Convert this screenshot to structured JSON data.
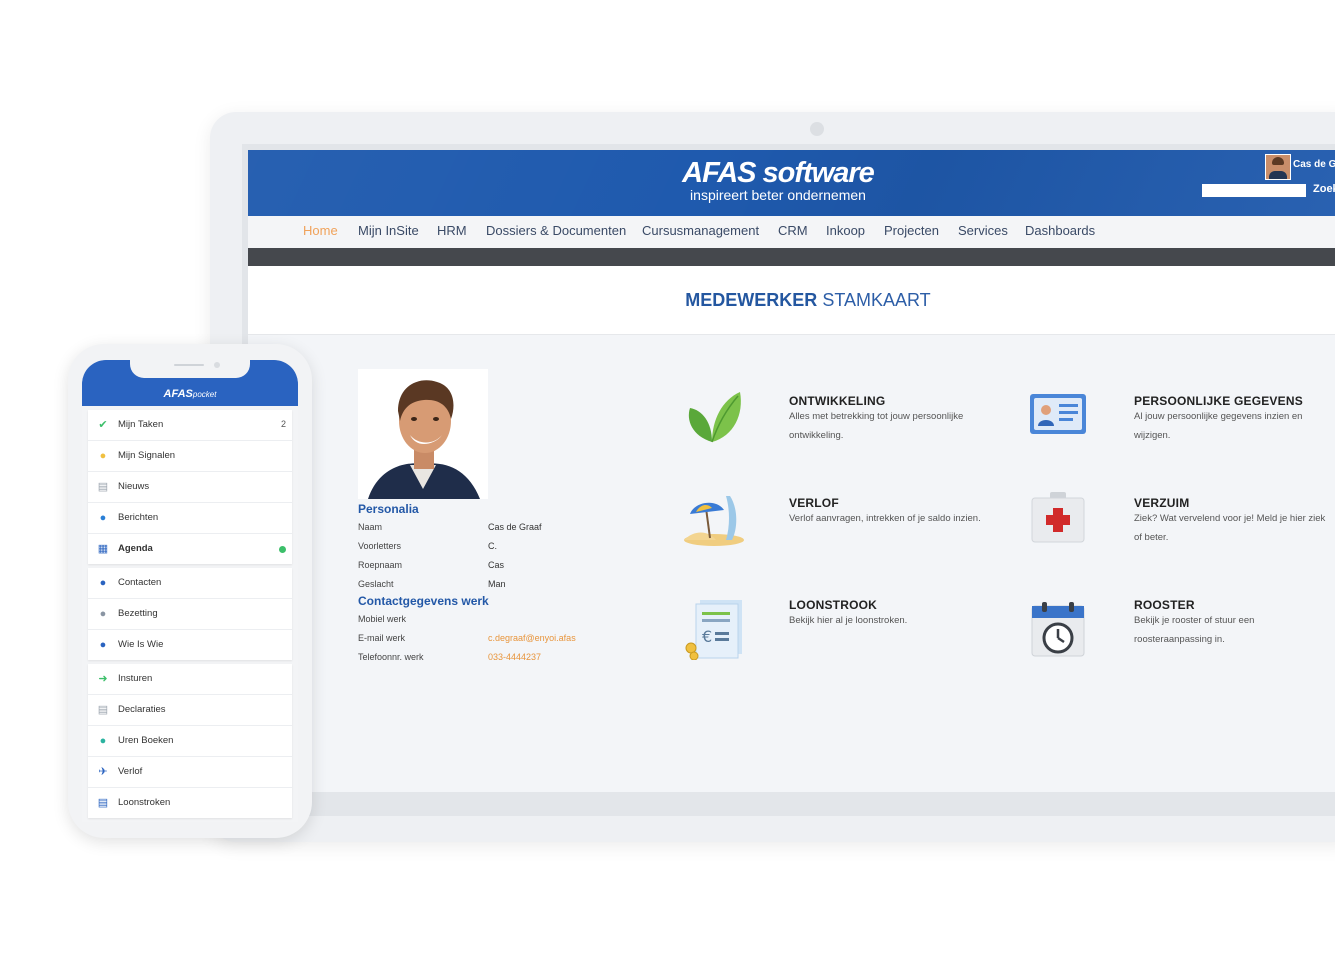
{
  "header": {
    "brand_main": "AFAS software",
    "brand_sub": "inspireert beter ondernemen",
    "user_name": "Cas de Graaf",
    "search_button": "Zoeken"
  },
  "nav": {
    "items": [
      "Home",
      "Mijn InSite",
      "HRM",
      "Dossiers & Documenten",
      "Cursusmanagement",
      "CRM",
      "Inkoop",
      "Projecten",
      "Services",
      "Dashboards"
    ],
    "active": "Home"
  },
  "page": {
    "title_bold": "MEDEWERKER",
    "title_rest": "STAMKAART"
  },
  "profile": {
    "personalia_heading": "Personalia",
    "fields": [
      {
        "label": "Naam",
        "value": "Cas de Graaf"
      },
      {
        "label": "Voorletters",
        "value": "C."
      },
      {
        "label": "Roepnaam",
        "value": "Cas"
      },
      {
        "label": "Geslacht",
        "value": "Man"
      }
    ],
    "contact_heading": "Contactgegevens werk",
    "contact_fields": [
      {
        "label": "Mobiel werk",
        "value": ""
      },
      {
        "label": "E-mail werk",
        "value": "c.degraaf@enyoi.afas"
      },
      {
        "label": "Telefoonnr. werk",
        "value": "033-4444237"
      }
    ]
  },
  "tiles": [
    {
      "title": "ONTWIKKELING",
      "desc": "Alles met betrekking tot jouw persoonlijke ontwikkeling.",
      "icon": "leaf-icon"
    },
    {
      "title": "PERSOONLIJKE GEGEVENS",
      "desc": "Al jouw persoonlijke gegevens inzien en wijzigen.",
      "icon": "id-card-icon"
    },
    {
      "title": "VERLOF",
      "desc": "Verlof aanvragen, intrekken of je saldo inzien.",
      "icon": "beach-icon"
    },
    {
      "title": "VERZUIM",
      "desc": "Ziek? Wat vervelend voor je! Meld je hier ziek of beter.",
      "icon": "first-aid-icon"
    },
    {
      "title": "LOONSTROOK",
      "desc": "Bekijk hier al je loonstroken.",
      "icon": "payslip-icon"
    },
    {
      "title": "ROOSTER",
      "desc": "Bekijk je rooster of stuur een roosteraanpassing in.",
      "icon": "calendar-clock-icon"
    }
  ],
  "phone": {
    "logo_main": "AFAS",
    "logo_sub": "pocket",
    "groups": [
      [
        {
          "label": "Mijn Taken",
          "icon": "check-icon",
          "count": "2"
        },
        {
          "label": "Mijn Signalen",
          "icon": "bulb-icon"
        },
        {
          "label": "Nieuws",
          "icon": "news-icon"
        },
        {
          "label": "Berichten",
          "icon": "chat-icon"
        },
        {
          "label": "Agenda",
          "icon": "calendar-icon",
          "bold": true,
          "dot": true
        }
      ],
      [
        {
          "label": "Contacten",
          "icon": "person-icon"
        },
        {
          "label": "Bezetting",
          "icon": "occupancy-icon"
        },
        {
          "label": "Wie Is Wie",
          "icon": "people-search-icon"
        }
      ],
      [
        {
          "label": "Insturen",
          "icon": "arrow-right-icon"
        },
        {
          "label": "Declaraties",
          "icon": "receipt-icon"
        },
        {
          "label": "Uren Boeken",
          "icon": "clock-icon"
        },
        {
          "label": "Verlof",
          "icon": "plane-icon"
        },
        {
          "label": "Loonstroken",
          "icon": "document-icon"
        }
      ]
    ]
  }
}
